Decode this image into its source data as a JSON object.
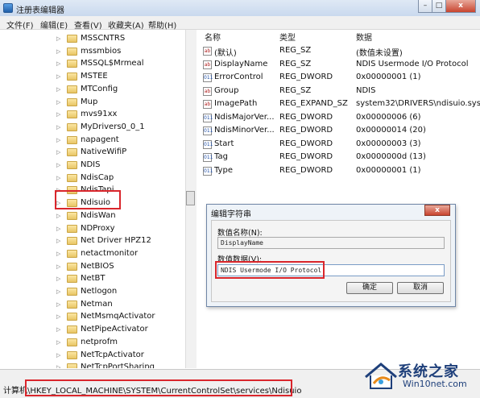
{
  "window": {
    "title": "注册表编辑器",
    "buttons": [
      "–",
      "□",
      "x"
    ]
  },
  "menu": [
    "文件(F)",
    "编辑(E)",
    "查看(V)",
    "收藏夹(A)",
    "帮助(H)"
  ],
  "tree": [
    {
      "label": "MSSCNTRS"
    },
    {
      "label": "mssmbios"
    },
    {
      "label": "MSSQL$Mrmeal"
    },
    {
      "label": "MSTEE"
    },
    {
      "label": "MTConfig"
    },
    {
      "label": "Mup"
    },
    {
      "label": "mvs91xx"
    },
    {
      "label": "MyDrivers0_0_1"
    },
    {
      "label": "napagent"
    },
    {
      "label": "NativeWifiP"
    },
    {
      "label": "NDIS"
    },
    {
      "label": "NdisCap"
    },
    {
      "label": "NdisTapi"
    },
    {
      "label": "Ndisuio",
      "selected": true
    },
    {
      "label": "NdisWan"
    },
    {
      "label": "NDProxy"
    },
    {
      "label": "Net Driver HPZ12"
    },
    {
      "label": "netactmonitor"
    },
    {
      "label": "NetBIOS"
    },
    {
      "label": "NetBT"
    },
    {
      "label": "Netlogon"
    },
    {
      "label": "Netman"
    },
    {
      "label": "NetMsmqActivator"
    },
    {
      "label": "NetPipeActivator"
    },
    {
      "label": "netprofm"
    },
    {
      "label": "NetTcpActivator"
    },
    {
      "label": "NetTcpPortSharing"
    }
  ],
  "columns": {
    "name": "名称",
    "type": "类型",
    "data": "数据"
  },
  "values": [
    {
      "icon": "ab",
      "name": "(默认)",
      "type": "REG_SZ",
      "data": "(数值未设置)"
    },
    {
      "icon": "ab",
      "name": "DisplayName",
      "type": "REG_SZ",
      "data": "NDIS Usermode I/O Protocol"
    },
    {
      "icon": "bin",
      "name": "ErrorControl",
      "type": "REG_DWORD",
      "data": "0x00000001 (1)"
    },
    {
      "icon": "ab",
      "name": "Group",
      "type": "REG_SZ",
      "data": "NDIS"
    },
    {
      "icon": "ab",
      "name": "ImagePath",
      "type": "REG_EXPAND_SZ",
      "data": "system32\\DRIVERS\\ndisuio.sys"
    },
    {
      "icon": "bin",
      "name": "NdisMajorVer...",
      "type": "REG_DWORD",
      "data": "0x00000006 (6)"
    },
    {
      "icon": "bin",
      "name": "NdisMinorVer...",
      "type": "REG_DWORD",
      "data": "0x00000014 (20)"
    },
    {
      "icon": "bin",
      "name": "Start",
      "type": "REG_DWORD",
      "data": "0x00000003 (3)"
    },
    {
      "icon": "bin",
      "name": "Tag",
      "type": "REG_DWORD",
      "data": "0x0000000d (13)"
    },
    {
      "icon": "bin",
      "name": "Type",
      "type": "REG_DWORD",
      "data": "0x00000001 (1)"
    }
  ],
  "dialog": {
    "title": "编辑字符串",
    "close": "x",
    "name_label": "数值名称(N):",
    "name_value": "DisplayName",
    "data_label": "数值数据(V):",
    "data_value": "NDIS Usermode I/O Protocol",
    "ok": "确定",
    "cancel": "取消"
  },
  "status": {
    "prefix": "计算机",
    "path": "\\HKEY_LOCAL_MACHINE\\SYSTEM\\CurrentControlSet\\services\\Ndisuio"
  },
  "watermark": {
    "brand": "系统之家",
    "site": "Win10net.com"
  },
  "colors": {
    "highlight": "#d9262c",
    "folder": "#e8c565",
    "watermark": "#1e3f7a"
  }
}
